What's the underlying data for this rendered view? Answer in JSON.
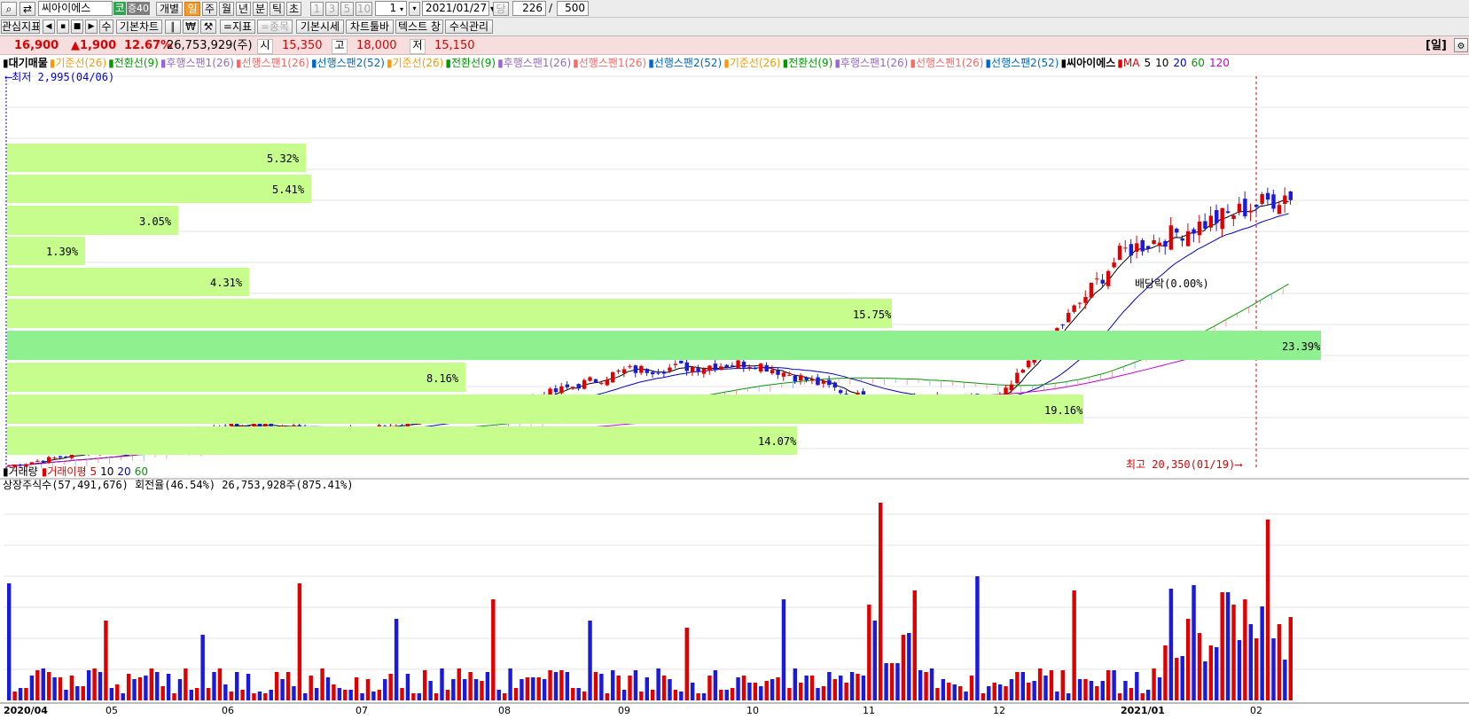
{
  "toolbar1": {
    "stock_name": "씨아이에스",
    "market_badge": "코",
    "margin_badge": "증40",
    "individual": "개별",
    "periods": [
      "일",
      "주",
      "월",
      "년",
      "분",
      "틱",
      "초"
    ],
    "active_period": "일",
    "multipliers": [
      "1",
      "3",
      "5",
      "10"
    ],
    "count_value": "1",
    "date": "2021/01/27",
    "dang": "당",
    "view_count": "226",
    "slash": "/",
    "total_count": "500"
  },
  "toolbar2": {
    "interest": "관심지표",
    "su": "수",
    "basic_chart": "기본차트",
    "won": "₩",
    "indicator": "=지표",
    "stock": "=종목",
    "basic_price": "기본시세",
    "chart_toolbar": "차트툴바",
    "text_window": "텍스트 창",
    "formula": "수식관리"
  },
  "quote": {
    "price": "16,900",
    "change": "▲1,900",
    "change_pct": "12.67%",
    "volume": "26,753,929(주)",
    "open_label": "시",
    "open": "15,350",
    "high_label": "고",
    "high": "18,000",
    "low_label": "저",
    "low": "15,150",
    "period_tag": "[일]"
  },
  "legend": {
    "items": [
      {
        "text": "대기매물",
        "color": "#000000"
      },
      {
        "text": "기준선(26)",
        "color": "#ff9900"
      },
      {
        "text": "전환선(9)",
        "color": "#009900"
      },
      {
        "text": "후행스팬1(26)",
        "color": "#9966cc"
      },
      {
        "text": "선행스팬1(26)",
        "color": "#ff6666"
      },
      {
        "text": "선행스팬2(52)",
        "color": "#0066cc"
      },
      {
        "text": "기준선(26)",
        "color": "#ff9900"
      },
      {
        "text": "전환선(9)",
        "color": "#009900"
      },
      {
        "text": "후행스팬1(26)",
        "color": "#9966cc"
      },
      {
        "text": "선행스팬1(26)",
        "color": "#ff6666"
      },
      {
        "text": "선행스팬2(52)",
        "color": "#0066cc"
      },
      {
        "text": "기준선(26)",
        "color": "#ff9900"
      },
      {
        "text": "전환선(9)",
        "color": "#009900"
      },
      {
        "text": "후행스팬1(26)",
        "color": "#9966cc"
      },
      {
        "text": "선행스팬1(26)",
        "color": "#ff6666"
      },
      {
        "text": "선행스팬2(52)",
        "color": "#0066cc"
      },
      {
        "text": "씨아이에스",
        "color": "#000000"
      }
    ],
    "ma_label": "MA",
    "ma": [
      {
        "text": "5",
        "color": "#000000"
      },
      {
        "text": "10",
        "color": "#000000"
      },
      {
        "text": "20",
        "color": "#0000cc"
      },
      {
        "text": "60",
        "color": "#009900"
      },
      {
        "text": "120",
        "color": "#cc00cc"
      }
    ]
  },
  "annotations": {
    "low": "최저 2,995(04/06)",
    "high": "최고 20,350(01/19)",
    "dividend": "배당락(0.00%)"
  },
  "volume_profile": [
    {
      "pct": "5.32%",
      "value": 5.32
    },
    {
      "pct": "5.41%",
      "value": 5.41
    },
    {
      "pct": "3.05%",
      "value": 3.05
    },
    {
      "pct": "1.39%",
      "value": 1.39
    },
    {
      "pct": "4.31%",
      "value": 4.31
    },
    {
      "pct": "15.75%",
      "value": 15.75
    },
    {
      "pct": "23.39%",
      "value": 23.39
    },
    {
      "pct": "8.16%",
      "value": 8.16
    },
    {
      "pct": "19.16%",
      "value": 19.16
    },
    {
      "pct": "14.07%",
      "value": 14.07
    }
  ],
  "volume_panel": {
    "legend": [
      {
        "text": "거래량",
        "color": "#000000"
      },
      {
        "text": "거래이평",
        "color": "#e00000"
      },
      {
        "text": "5",
        "color": "#e00000"
      },
      {
        "text": "10",
        "color": "#000000"
      },
      {
        "text": "20",
        "color": "#0000cc"
      },
      {
        "text": "60",
        "color": "#009900"
      }
    ],
    "shares": "상장주식수(57,491,676) 회전율(46.54%) 26,753,928주(875.41%)"
  },
  "x_axis": [
    "2020/04",
    "05",
    "06",
    "07",
    "08",
    "09",
    "10",
    "11",
    "12",
    "2021/01",
    "02"
  ],
  "colors": {
    "up": "#e00000",
    "down": "#1a1adc",
    "profile": "#c7fd8c",
    "profile_max": "#8ff08f"
  },
  "chart_data": {
    "type": "candlestick",
    "price_low": 2995,
    "price_high": 20350,
    "closing_trend": [
      [
        "2020/04",
        3200
      ],
      [
        "2020/05",
        4100
      ],
      [
        "2020/06",
        5300
      ],
      [
        "2020/07",
        5000
      ],
      [
        "2020/08",
        6200
      ],
      [
        "2020/09",
        8000
      ],
      [
        "2020/10",
        8400
      ],
      [
        "2020/11",
        6500
      ],
      [
        "2020/12",
        6600
      ],
      [
        "2021/01",
        14000
      ],
      [
        "2021/01/27",
        16900
      ]
    ],
    "volume_profile_pct": [
      5.32,
      5.41,
      3.05,
      1.39,
      4.31,
      15.75,
      23.39,
      8.16,
      19.16,
      14.07
    ]
  }
}
